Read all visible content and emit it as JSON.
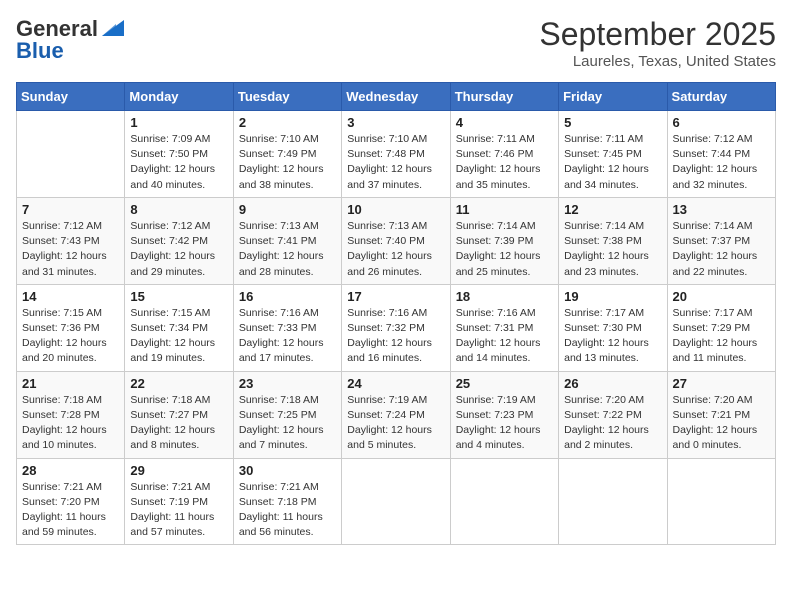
{
  "header": {
    "logo_general": "General",
    "logo_blue": "Blue",
    "month": "September 2025",
    "location": "Laureles, Texas, United States"
  },
  "days_of_week": [
    "Sunday",
    "Monday",
    "Tuesday",
    "Wednesday",
    "Thursday",
    "Friday",
    "Saturday"
  ],
  "weeks": [
    [
      {
        "day": "",
        "info": ""
      },
      {
        "day": "1",
        "info": "Sunrise: 7:09 AM\nSunset: 7:50 PM\nDaylight: 12 hours\nand 40 minutes."
      },
      {
        "day": "2",
        "info": "Sunrise: 7:10 AM\nSunset: 7:49 PM\nDaylight: 12 hours\nand 38 minutes."
      },
      {
        "day": "3",
        "info": "Sunrise: 7:10 AM\nSunset: 7:48 PM\nDaylight: 12 hours\nand 37 minutes."
      },
      {
        "day": "4",
        "info": "Sunrise: 7:11 AM\nSunset: 7:46 PM\nDaylight: 12 hours\nand 35 minutes."
      },
      {
        "day": "5",
        "info": "Sunrise: 7:11 AM\nSunset: 7:45 PM\nDaylight: 12 hours\nand 34 minutes."
      },
      {
        "day": "6",
        "info": "Sunrise: 7:12 AM\nSunset: 7:44 PM\nDaylight: 12 hours\nand 32 minutes."
      }
    ],
    [
      {
        "day": "7",
        "info": "Sunrise: 7:12 AM\nSunset: 7:43 PM\nDaylight: 12 hours\nand 31 minutes."
      },
      {
        "day": "8",
        "info": "Sunrise: 7:12 AM\nSunset: 7:42 PM\nDaylight: 12 hours\nand 29 minutes."
      },
      {
        "day": "9",
        "info": "Sunrise: 7:13 AM\nSunset: 7:41 PM\nDaylight: 12 hours\nand 28 minutes."
      },
      {
        "day": "10",
        "info": "Sunrise: 7:13 AM\nSunset: 7:40 PM\nDaylight: 12 hours\nand 26 minutes."
      },
      {
        "day": "11",
        "info": "Sunrise: 7:14 AM\nSunset: 7:39 PM\nDaylight: 12 hours\nand 25 minutes."
      },
      {
        "day": "12",
        "info": "Sunrise: 7:14 AM\nSunset: 7:38 PM\nDaylight: 12 hours\nand 23 minutes."
      },
      {
        "day": "13",
        "info": "Sunrise: 7:14 AM\nSunset: 7:37 PM\nDaylight: 12 hours\nand 22 minutes."
      }
    ],
    [
      {
        "day": "14",
        "info": "Sunrise: 7:15 AM\nSunset: 7:36 PM\nDaylight: 12 hours\nand 20 minutes."
      },
      {
        "day": "15",
        "info": "Sunrise: 7:15 AM\nSunset: 7:34 PM\nDaylight: 12 hours\nand 19 minutes."
      },
      {
        "day": "16",
        "info": "Sunrise: 7:16 AM\nSunset: 7:33 PM\nDaylight: 12 hours\nand 17 minutes."
      },
      {
        "day": "17",
        "info": "Sunrise: 7:16 AM\nSunset: 7:32 PM\nDaylight: 12 hours\nand 16 minutes."
      },
      {
        "day": "18",
        "info": "Sunrise: 7:16 AM\nSunset: 7:31 PM\nDaylight: 12 hours\nand 14 minutes."
      },
      {
        "day": "19",
        "info": "Sunrise: 7:17 AM\nSunset: 7:30 PM\nDaylight: 12 hours\nand 13 minutes."
      },
      {
        "day": "20",
        "info": "Sunrise: 7:17 AM\nSunset: 7:29 PM\nDaylight: 12 hours\nand 11 minutes."
      }
    ],
    [
      {
        "day": "21",
        "info": "Sunrise: 7:18 AM\nSunset: 7:28 PM\nDaylight: 12 hours\nand 10 minutes."
      },
      {
        "day": "22",
        "info": "Sunrise: 7:18 AM\nSunset: 7:27 PM\nDaylight: 12 hours\nand 8 minutes."
      },
      {
        "day": "23",
        "info": "Sunrise: 7:18 AM\nSunset: 7:25 PM\nDaylight: 12 hours\nand 7 minutes."
      },
      {
        "day": "24",
        "info": "Sunrise: 7:19 AM\nSunset: 7:24 PM\nDaylight: 12 hours\nand 5 minutes."
      },
      {
        "day": "25",
        "info": "Sunrise: 7:19 AM\nSunset: 7:23 PM\nDaylight: 12 hours\nand 4 minutes."
      },
      {
        "day": "26",
        "info": "Sunrise: 7:20 AM\nSunset: 7:22 PM\nDaylight: 12 hours\nand 2 minutes."
      },
      {
        "day": "27",
        "info": "Sunrise: 7:20 AM\nSunset: 7:21 PM\nDaylight: 12 hours\nand 0 minutes."
      }
    ],
    [
      {
        "day": "28",
        "info": "Sunrise: 7:21 AM\nSunset: 7:20 PM\nDaylight: 11 hours\nand 59 minutes."
      },
      {
        "day": "29",
        "info": "Sunrise: 7:21 AM\nSunset: 7:19 PM\nDaylight: 11 hours\nand 57 minutes."
      },
      {
        "day": "30",
        "info": "Sunrise: 7:21 AM\nSunset: 7:18 PM\nDaylight: 11 hours\nand 56 minutes."
      },
      {
        "day": "",
        "info": ""
      },
      {
        "day": "",
        "info": ""
      },
      {
        "day": "",
        "info": ""
      },
      {
        "day": "",
        "info": ""
      }
    ]
  ]
}
